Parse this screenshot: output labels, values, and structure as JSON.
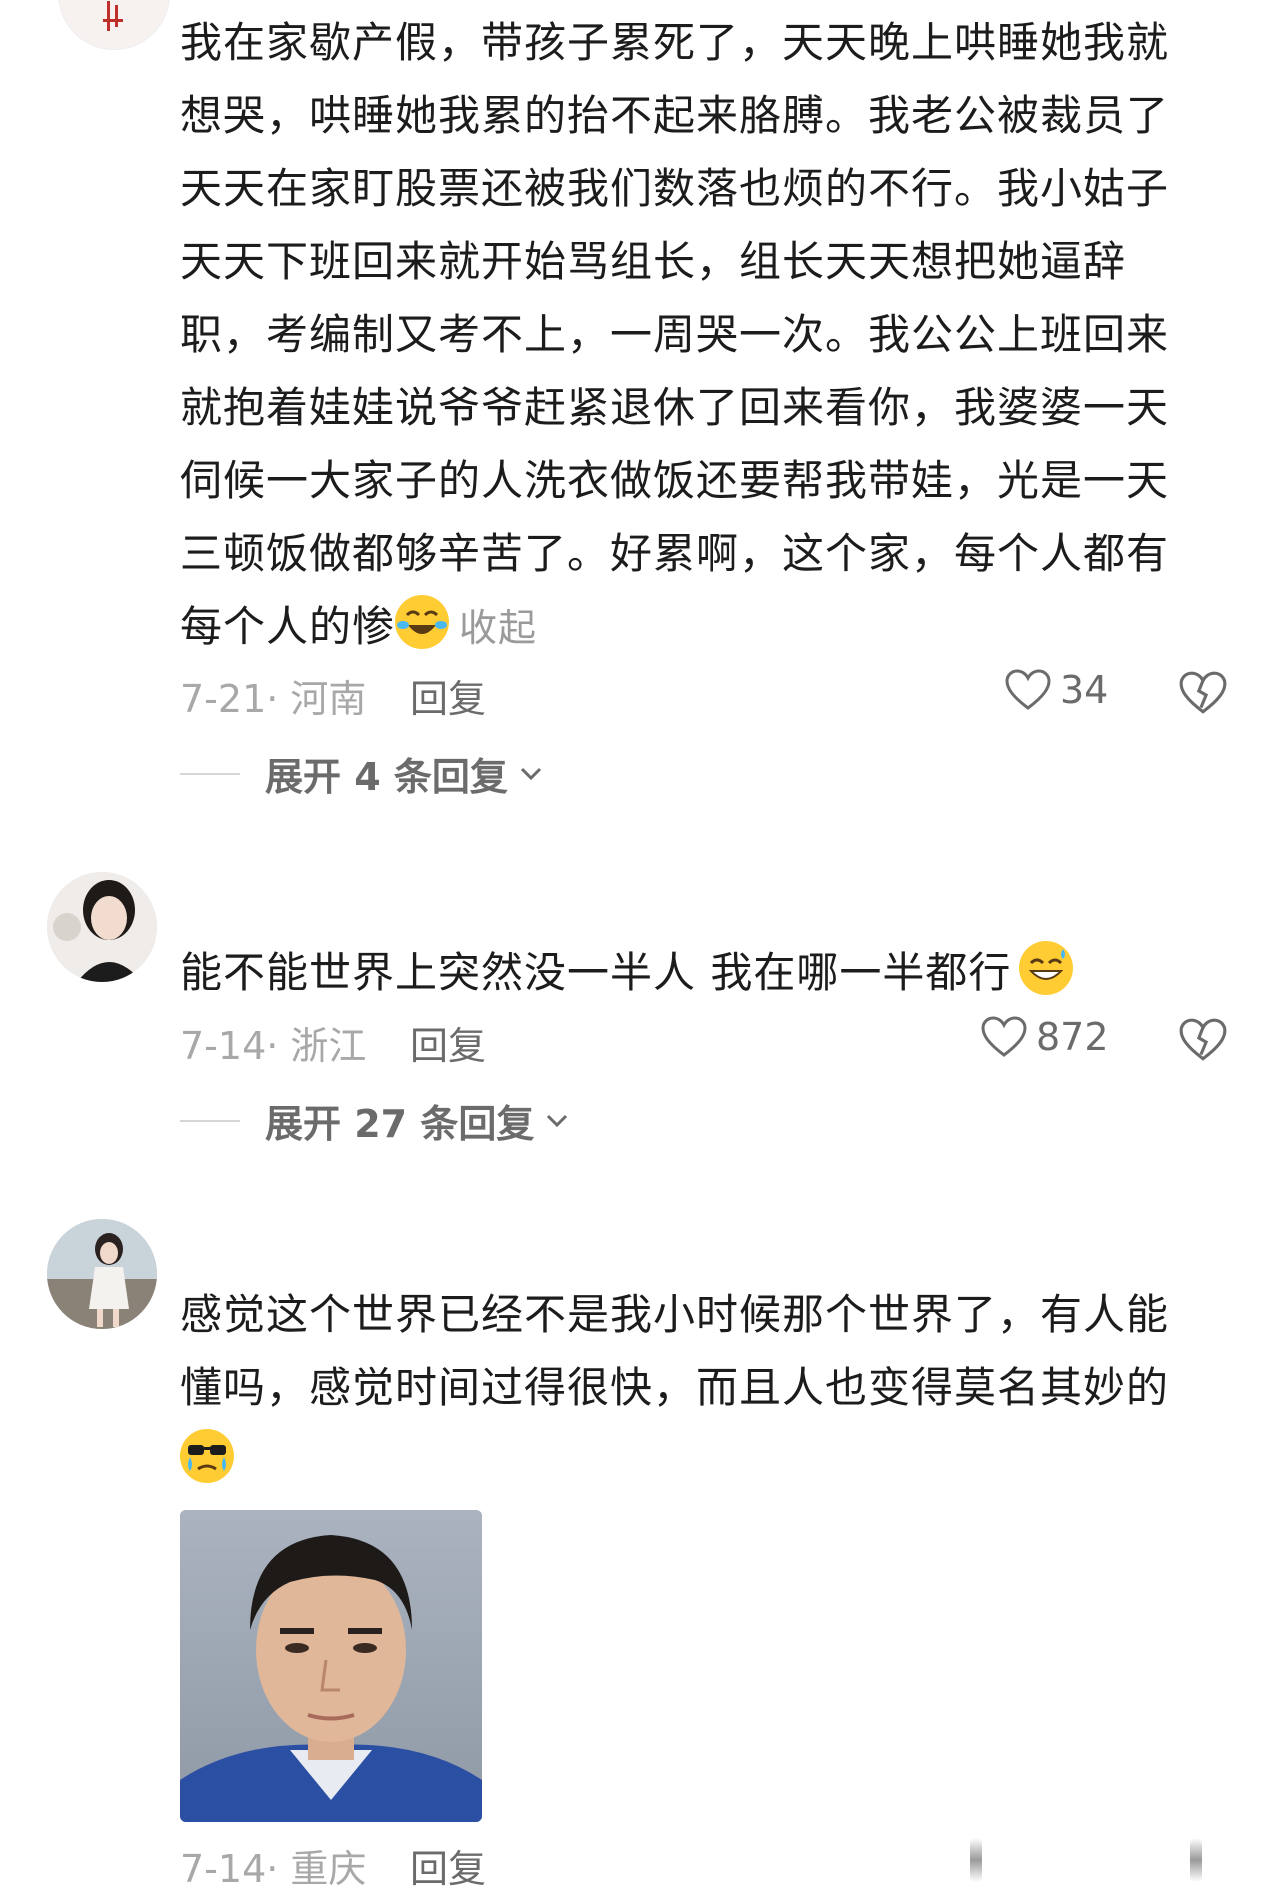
{
  "comments": [
    {
      "text": "我在家歇产假，带孩子累死了，天天晚上哄睡她我就想哭，哄睡她我累的抬不起来胳膊。我老公被裁员了天天在家盯股票还被我们数落也烦的不行。我小姑子天天下班回来就开始骂组长，组长天天想把她逼辞职，考编制又考不上，一周哭一次。我公公上班回来就抱着娃娃说爷爷赶紧退休了回来看你，我婆婆一天伺候一大家子的人洗衣做饭还要帮我带娃，光是一天三顿饭做都够辛苦了。好累啊，这个家，每个人都有每个人的惨",
      "emoji": "laughing-crying-emoji",
      "collapse_label": "收起",
      "date_location": "7-21· 河南",
      "reply_label": "回复",
      "likes": "34",
      "expand_label": "展开 4 条回复"
    },
    {
      "text": "能不能世界上突然没一半人 我在哪一半都行",
      "emoji": "grin-sweat-emoji",
      "date_location": "7-14· 浙江",
      "reply_label": "回复",
      "likes": "872",
      "expand_label": "展开 27 条回复"
    },
    {
      "text": "感觉这个世界已经不是我小时候那个世界了，有人能懂吗，感觉时间过得很快，而且人也变得莫名其妙的",
      "emoji": "cool-crying-emoji",
      "date_location": "7-14· 重庆",
      "reply_label": "回复"
    }
  ],
  "colors": {
    "text": "#1c1c1c",
    "meta": "#a8a8a8",
    "secondary": "#6b6b6b",
    "emoji": "#ffcc33"
  }
}
